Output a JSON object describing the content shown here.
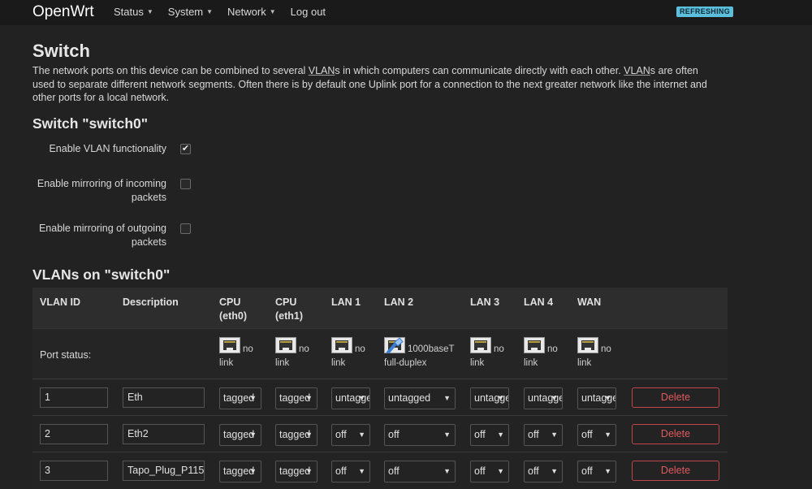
{
  "nav": {
    "brand": "OpenWrt",
    "menu": [
      "Status",
      "System",
      "Network",
      "Log out"
    ],
    "status_badge": "REFRESHING"
  },
  "page": {
    "title": "Switch",
    "description": {
      "p1": "The network ports on this device can be combined to several ",
      "vlan1": "VLAN",
      "p2": "s in which computers can communicate directly with each other. ",
      "vlan2": "VLAN",
      "p3": "s are often used to separate different network segments. Often there is by default one Uplink port for a connection to the next greater network like the internet and other ports for a local network."
    }
  },
  "switch_section": {
    "title": "Switch \"switch0\"",
    "options": [
      {
        "label": "Enable VLAN functionality",
        "checked": true
      },
      {
        "label": "Enable mirroring of incoming packets",
        "checked": false
      },
      {
        "label": "Enable mirroring of outgoing packets",
        "checked": false
      }
    ]
  },
  "vlans": {
    "title": "VLANs on \"switch0\"",
    "headers": [
      "VLAN ID",
      "Description",
      "CPU (eth0)",
      "CPU (eth1)",
      "LAN 1",
      "LAN 2",
      "LAN 3",
      "LAN 4",
      "WAN"
    ],
    "port_status_label": "Port status:",
    "port_status": [
      {
        "port": "CPU (eth0)",
        "text": "no link",
        "link": false
      },
      {
        "port": "CPU (eth1)",
        "text": "no link",
        "link": false
      },
      {
        "port": "LAN 1",
        "text": "no link",
        "link": false
      },
      {
        "port": "LAN 2",
        "text": "1000baseT full-duplex",
        "link": true
      },
      {
        "port": "LAN 3",
        "text": "no link",
        "link": false
      },
      {
        "port": "LAN 4",
        "text": "no link",
        "link": false
      },
      {
        "port": "WAN",
        "text": "no link",
        "link": false
      }
    ],
    "rows": [
      {
        "id": "1",
        "description": "Eth",
        "ports": [
          "tagged",
          "tagged",
          "untagged",
          "untagged",
          "untagged",
          "untagged",
          "untagged"
        ]
      },
      {
        "id": "2",
        "description": "Eth2",
        "ports": [
          "tagged",
          "tagged",
          "off",
          "off",
          "off",
          "off",
          "off"
        ]
      },
      {
        "id": "3",
        "description": "Tapo_Plug_P115",
        "ports": [
          "tagged",
          "tagged",
          "off",
          "off",
          "off",
          "off",
          "off"
        ]
      }
    ],
    "delete_label": "Delete"
  },
  "colors": {
    "background": "#222222",
    "accent_badge": "#5bc0de",
    "delete": "#e05a5e"
  }
}
